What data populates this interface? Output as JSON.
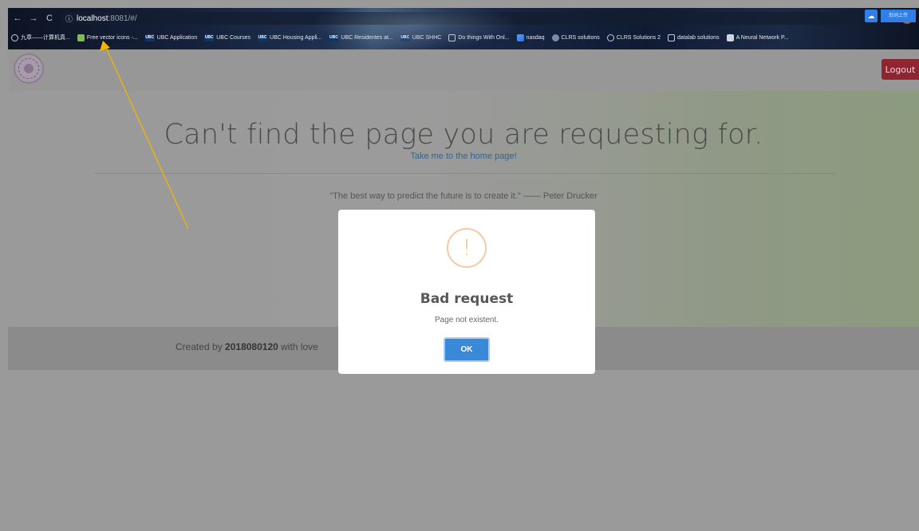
{
  "browser": {
    "url_host": "localhost",
    "url_path": ":8081/#/",
    "bookmarks": [
      {
        "label": "九章——计算机真...",
        "icon": "globe-icon"
      },
      {
        "label": "Free vector icons -...",
        "icon": "leaf-icon"
      },
      {
        "label": "UBC Application",
        "icon": "ubc-icon"
      },
      {
        "label": "UBC Courses",
        "icon": "ubc-icon"
      },
      {
        "label": "UBC Housing Appli...",
        "icon": "ubc-icon"
      },
      {
        "label": "UBC Residentes at...",
        "icon": "ubc-icon"
      },
      {
        "label": "UBC SHHC",
        "icon": "ubc-icon"
      },
      {
        "label": "Do things With Onl...",
        "icon": "box-icon"
      },
      {
        "label": "nasdaq",
        "icon": "chart-icon"
      },
      {
        "label": "CLRS solutions",
        "icon": "dot-icon"
      },
      {
        "label": "CLRS Solutions 2",
        "icon": "globe-icon"
      },
      {
        "label": "datalab solutions",
        "icon": "box-icon"
      },
      {
        "label": "A Neural Network P...",
        "icon": "blog-icon"
      }
    ],
    "extension_label": "划词上传"
  },
  "navbar": {
    "logout_label": "Logout"
  },
  "jumbotron": {
    "title": "Can't find the page you are requesting for.",
    "home_link": "Take me to the home page!",
    "quote": "\"The best way to predict the future is to create it.\" —— Peter Drucker"
  },
  "footer": {
    "prefix": "Created by",
    "author": "2018080120",
    "suffix": "with love"
  },
  "modal": {
    "icon": "!",
    "title": "Bad request",
    "text": "Page not existent.",
    "ok_label": "OK"
  },
  "annotation": {
    "color": "#f5b400"
  }
}
